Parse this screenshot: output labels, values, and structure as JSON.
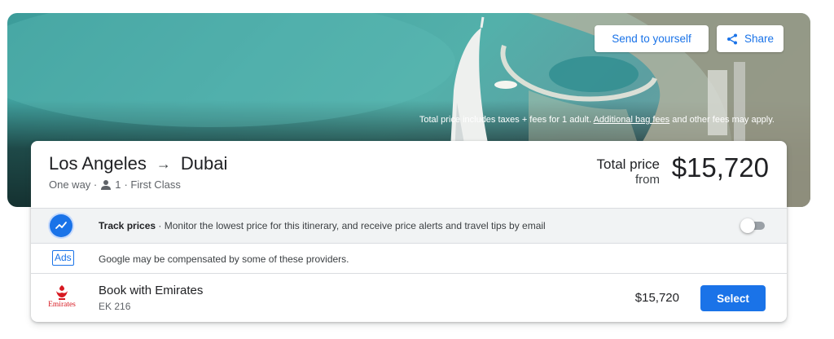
{
  "hero": {
    "send_label": "Send to yourself",
    "share_label": "Share",
    "disclaimer_before": "Total price includes taxes + fees for 1 adult. ",
    "disclaimer_link": "Additional bag fees",
    "disclaimer_after": " and other fees may apply."
  },
  "route": {
    "origin": "Los Angeles",
    "arrow": "→",
    "destination": "Dubai",
    "trip_type": "One way ·",
    "passengers": "1",
    "cabin": "· First Class"
  },
  "total": {
    "label": "Total price",
    "from_label": "from",
    "price": "$15,720"
  },
  "track": {
    "title": "Track prices",
    "description": " · Monitor the lowest price for this itinerary, and receive price alerts and travel tips by email",
    "enabled": false
  },
  "ads": {
    "badge": "Ads",
    "text": "Google may be compensated by some of these providers."
  },
  "provider": {
    "logo_text": "Emirates",
    "name": "Book with Emirates",
    "flight": "EK 216",
    "price": "$15,720",
    "select_label": "Select"
  },
  "colors": {
    "accent": "#1a73e8",
    "brand_emirates": "#d71921"
  },
  "icons": [
    "share-icon",
    "person-icon",
    "price-trend-icon",
    "emirates-logo"
  ]
}
